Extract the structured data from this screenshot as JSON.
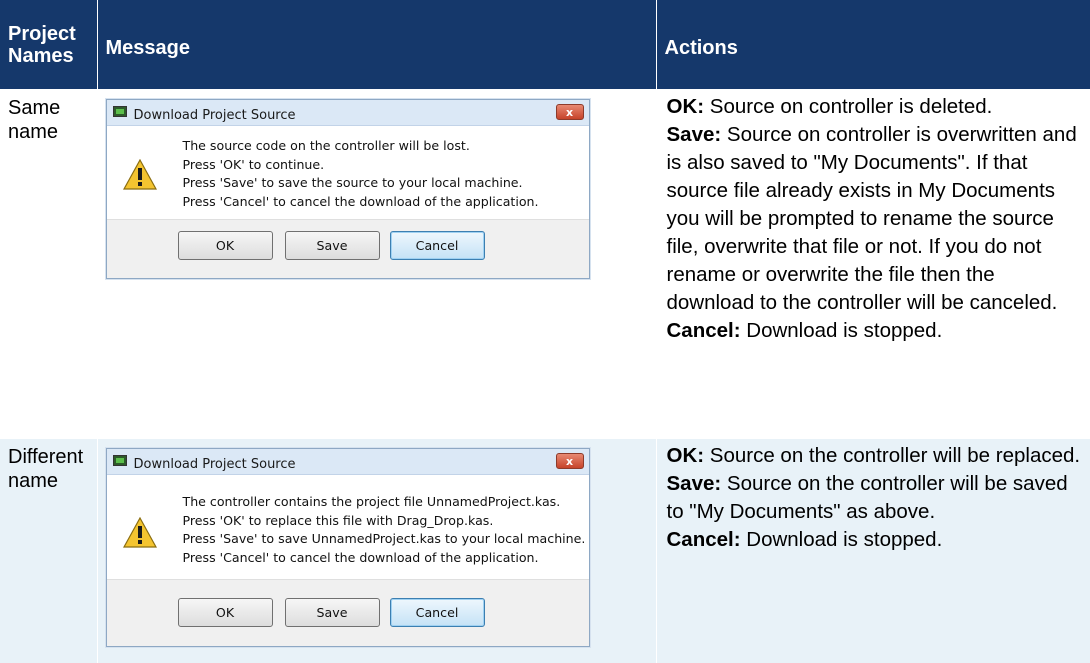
{
  "header": {
    "col1": "Project Names",
    "col2": "Message",
    "col3": "Actions"
  },
  "rows": [
    {
      "name": "Same name",
      "dialog": {
        "title": "Download Project Source",
        "close_label": "x",
        "icon": "warning-icon",
        "lines": [
          "The source code on the controller will be lost.",
          "Press 'OK' to continue.",
          "Press 'Save' to save the source to your local machine.",
          "Press 'Cancel' to cancel the download of the application."
        ],
        "buttons": {
          "ok": "OK",
          "save": "Save",
          "cancel": "Cancel"
        }
      },
      "actions": {
        "ok_label": "OK:",
        "ok_text": " Source on controller is deleted.",
        "save_label": "Save:",
        "save_text": " Source on controller is overwritten and is also saved to \"My Documents\". If that source file already exists in My Documents you will be prompted to rename the source file, overwrite that file or not. If you do not rename or overwrite the file then the download to the controller will be canceled.",
        "cancel_label": "Cancel:",
        "cancel_text": " Download is stopped."
      }
    },
    {
      "name": "Different name",
      "dialog": {
        "title": "Download Project Source",
        "close_label": "x",
        "icon": "warning-icon",
        "lines": [
          "The controller contains the project file UnnamedProject.kas.",
          "Press 'OK' to replace this file with Drag_Drop.kas.",
          "Press 'Save' to save UnnamedProject.kas to your local machine.",
          "Press 'Cancel' to cancel the download of the application."
        ],
        "buttons": {
          "ok": "OK",
          "save": "Save",
          "cancel": "Cancel"
        }
      },
      "actions": {
        "ok_label": "OK:",
        "ok_text": " Source on the controller will be replaced.",
        "save_label": "Save:",
        "save_text": " Source on the controller will be saved to \"My Documents\" as above.",
        "cancel_label": "Cancel:",
        "cancel_text": " Download is stopped."
      }
    }
  ],
  "colors": {
    "header_bg": "#15386b",
    "header_text": "#ffffff",
    "row_alt_bg": "#e8f2f8"
  }
}
